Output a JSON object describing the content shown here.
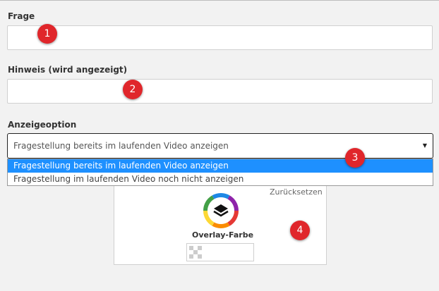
{
  "fields": {
    "question": {
      "label": "Frage",
      "value": "",
      "placeholder": ""
    },
    "hint": {
      "label": "Hinweis (wird angezeigt)",
      "value": "",
      "placeholder": ""
    }
  },
  "display_option": {
    "label": "Anzeigeoption",
    "selected": "Fragestellung bereits im laufenden Video anzeigen",
    "options": [
      "Fragestellung bereits im laufenden Video anzeigen",
      "Fragestellung im laufenden Video noch nicht anzeigen"
    ],
    "highlighted_option": 1
  },
  "overlay": {
    "reset_label": "Zurücksetzen",
    "label": "Overlay-Farbe",
    "icon": "color-wheel-layers-icon"
  },
  "badges": [
    "1",
    "2",
    "3",
    "4"
  ],
  "colors": {
    "badge": "#e0262b",
    "dropdown_highlight": "#1e90ff",
    "background": "#f2f2f2"
  }
}
